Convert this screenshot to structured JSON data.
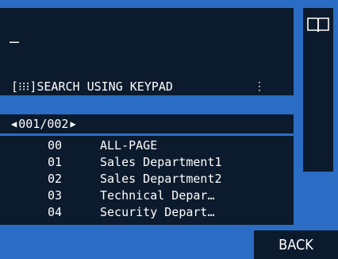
{
  "input": {
    "value": "–"
  },
  "search": {
    "icon": "keypad-grid-icon",
    "label": "[⁝⁝⁝]SEARCH USING KEYPAD",
    "scroll_icon": "up-down-arrows-icon"
  },
  "right_panel": {
    "icon": "book-icon"
  },
  "pager": {
    "text": "001/002"
  },
  "list": {
    "items": [
      {
        "code": "00",
        "label": "ALL-PAGE"
      },
      {
        "code": "01",
        "label": "Sales Department1"
      },
      {
        "code": "02",
        "label": "Sales Department2"
      },
      {
        "code": "03",
        "label": "Technical Depar…"
      },
      {
        "code": "04",
        "label": "Security Depart…"
      }
    ]
  },
  "back_button": {
    "label": "BACK"
  },
  "colors": {
    "background": "#2b6cc4",
    "panel": "#0b1a2c",
    "text": "#ffffff"
  }
}
